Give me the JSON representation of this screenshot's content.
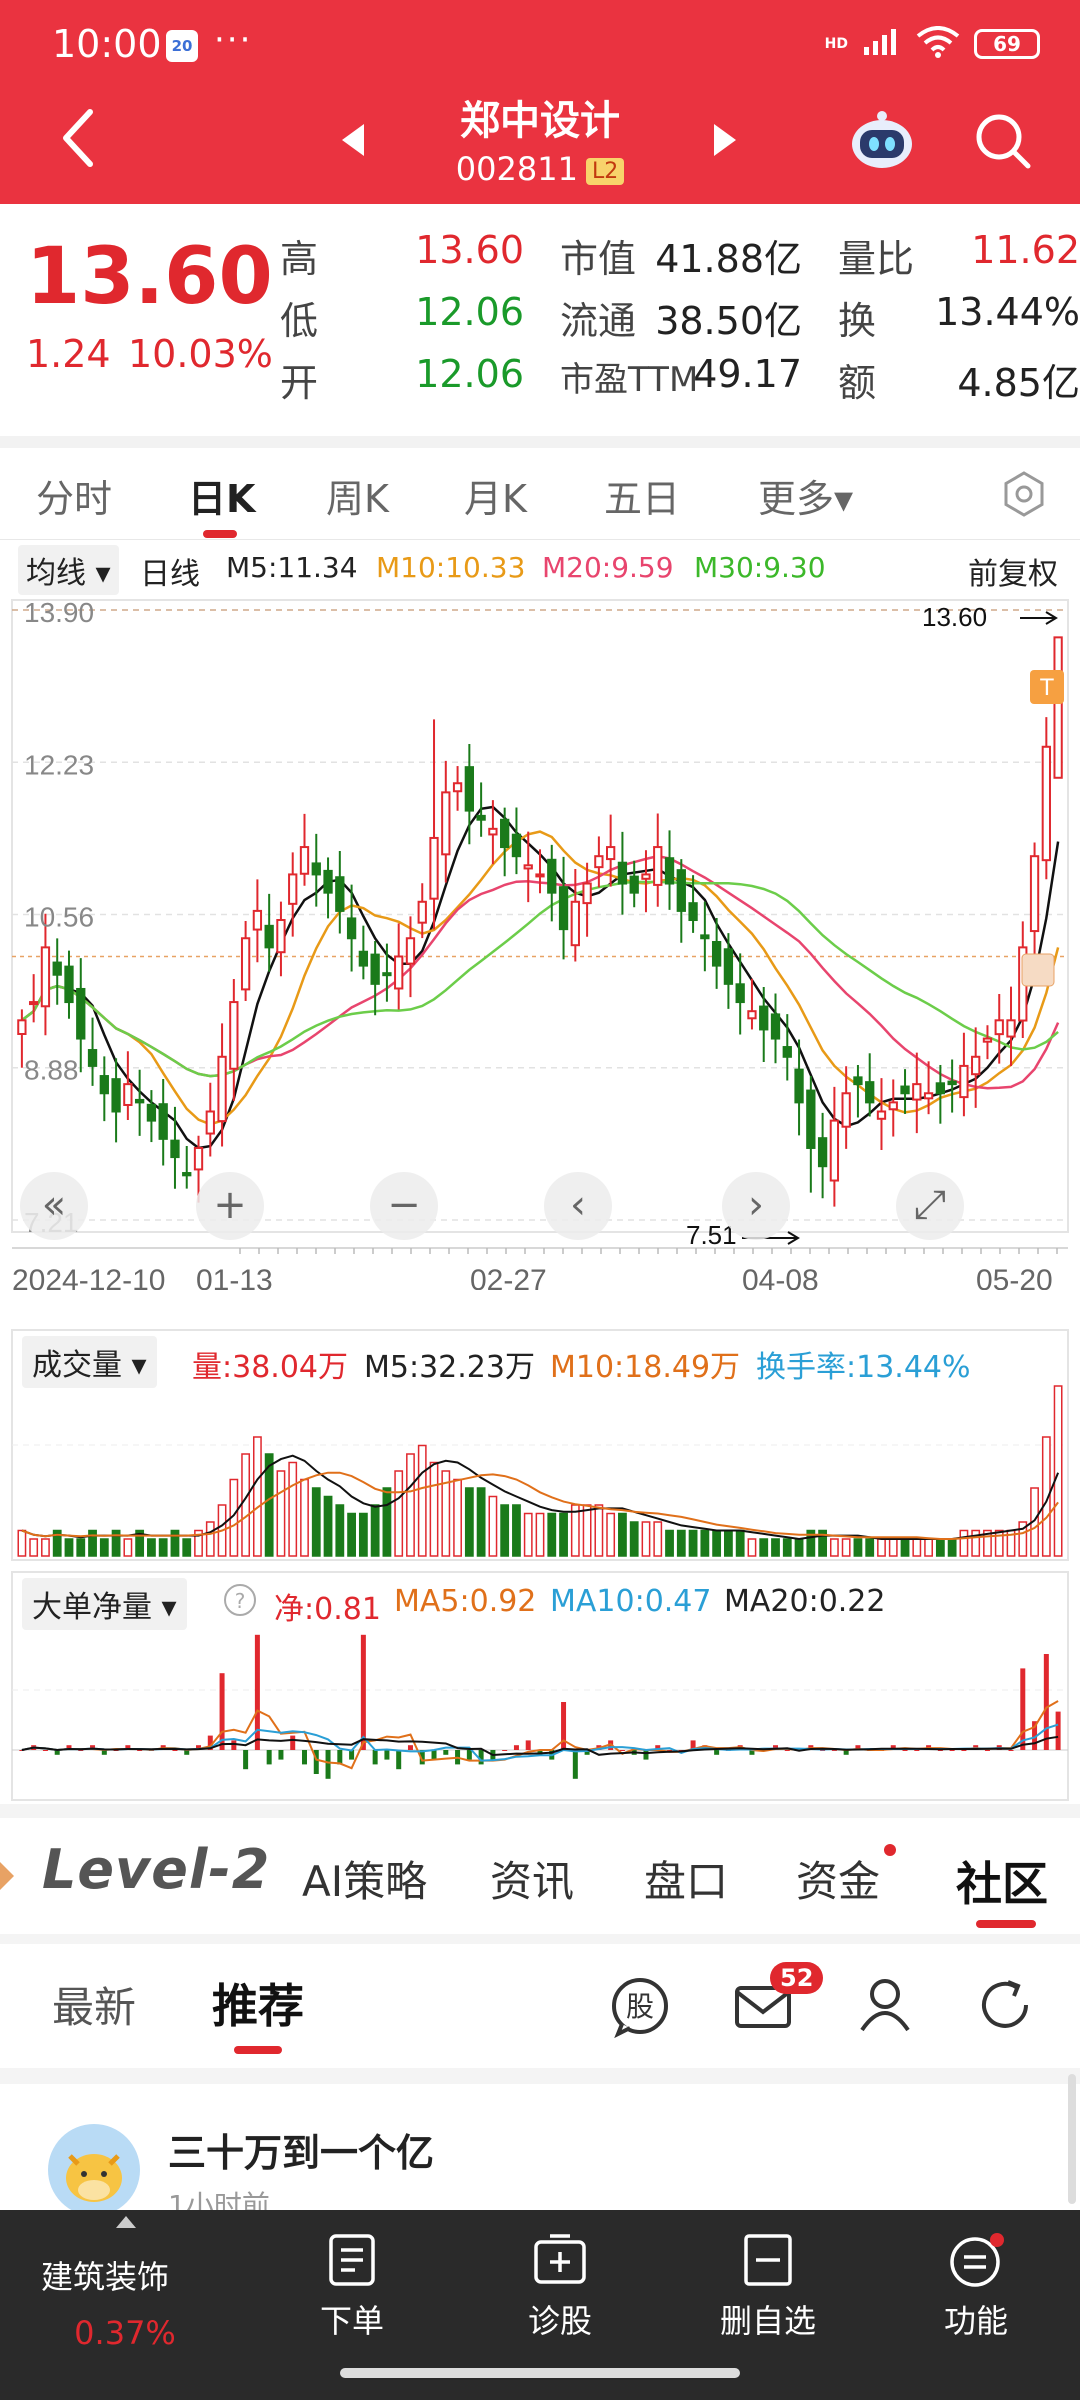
{
  "status": {
    "time": "10:00",
    "badge": "20",
    "dots": "···",
    "battery": "69",
    "network": "HD"
  },
  "header": {
    "name": "郑中设计",
    "code": "002811",
    "level": "L2"
  },
  "quote": {
    "price": "13.60",
    "change_abs": "1.24",
    "change_pct": "10.03%",
    "rows": [
      [
        {
          "label": "高",
          "value": "13.60"
        },
        {
          "label": "市值",
          "value": "41.88亿"
        },
        {
          "label": "量比",
          "value": "11.62"
        }
      ],
      [
        {
          "label": "低",
          "value": "12.06"
        },
        {
          "label": "流通",
          "value": "38.50亿"
        },
        {
          "label": "换",
          "value": "13.44%"
        }
      ],
      [
        {
          "label": "开",
          "value": "12.06"
        },
        {
          "label": "市盈TTM",
          "value": "49.17"
        },
        {
          "label": "额",
          "value": "4.85亿"
        }
      ]
    ]
  },
  "tabs": [
    "分时",
    "日K",
    "周K",
    "月K",
    "五日",
    "更多▾"
  ],
  "ma_row": {
    "dropdown": "均线 ▾",
    "period": "日线",
    "m5": "M5:11.34",
    "m10": "M10:10.33",
    "m20": "M20:9.59",
    "m30": "M30:9.30",
    "adjust": "前复权"
  },
  "colors": {
    "up": "#e0282e",
    "down": "#1a7a1a",
    "m5": "#111111",
    "m10": "#e89a17",
    "m20": "#e8456e",
    "m30": "#6ccd4a",
    "header": "#ea3340"
  },
  "chart_data": [
    {
      "type": "candlestick",
      "y_ticks": [
        "13.90",
        "12.23",
        "10.56",
        "8.88",
        "7.21"
      ],
      "ylim": [
        7.21,
        13.9
      ],
      "x_ticks": [
        "2024-12-10",
        "01-13",
        "02-27",
        "04-08",
        "05-20"
      ],
      "max_label": "13.60",
      "min_label": "7.51",
      "last_close": 13.6,
      "legend": [
        "M5:11.34",
        "M10:10.33",
        "M20:9.59",
        "M30:9.30"
      ],
      "closes": [
        9.4,
        9.6,
        10.2,
        9.9,
        9.6,
        9.2,
        8.9,
        8.6,
        8.4,
        8.7,
        8.5,
        8.3,
        8.1,
        7.9,
        7.7,
        8.0,
        8.4,
        9.0,
        9.6,
        10.3,
        10.6,
        10.2,
        10.5,
        11.0,
        11.3,
        11.0,
        10.8,
        10.6,
        10.3,
        10.0,
        9.8,
        9.9,
        10.1,
        10.3,
        10.7,
        11.4,
        11.9,
        12.0,
        11.7,
        11.6,
        11.5,
        11.3,
        11.2,
        11.1,
        11.0,
        10.8,
        10.4,
        10.7,
        10.9,
        11.2,
        11.3,
        10.9,
        10.8,
        11.0,
        11.3,
        10.9,
        10.6,
        10.5,
        10.3,
        10.0,
        9.8,
        9.6,
        9.5,
        9.3,
        9.2,
        9.0,
        8.5,
        8.0,
        7.8,
        8.3,
        8.6,
        8.7,
        8.5,
        8.4,
        8.5,
        8.6,
        8.7,
        8.6,
        8.6,
        8.7,
        8.9,
        9.0,
        9.2,
        9.4,
        9.4,
        10.2,
        11.2,
        12.4,
        13.6
      ]
    },
    {
      "type": "bar",
      "title": "成交量",
      "legend": [
        "量:38.04万",
        "M5:32.23万",
        "M10:18.49万",
        "换手率:13.44%"
      ],
      "values": [
        3,
        2,
        2,
        3,
        2,
        2,
        3,
        2,
        3,
        2,
        3,
        2,
        2,
        3,
        2,
        3,
        4,
        6,
        9,
        12,
        14,
        12,
        10,
        11,
        9,
        8,
        7,
        6,
        5,
        5,
        6,
        8,
        10,
        12,
        13,
        11,
        10,
        9,
        8,
        8,
        7,
        6,
        6,
        5,
        5,
        5,
        5,
        6,
        6,
        6,
        5,
        5,
        4,
        4,
        4,
        3,
        3,
        3,
        3,
        3,
        3,
        3,
        2,
        2,
        2,
        2,
        2,
        3,
        3,
        2,
        2,
        2,
        2,
        2,
        2,
        2,
        2,
        2,
        2,
        2,
        3,
        3,
        3,
        3,
        3,
        4,
        8,
        14,
        20
      ]
    },
    {
      "type": "bar",
      "title": "大单净量",
      "legend": [
        "净:0.81",
        "MA5:0.92",
        "MA10:0.47",
        "MA20:0.22"
      ],
      "values": [
        0,
        0.1,
        0,
        -0.1,
        0.1,
        0,
        0.1,
        -0.1,
        0,
        0.1,
        0,
        0,
        0.1,
        0,
        -0.1,
        0.1,
        0.3,
        1.6,
        0.2,
        -0.4,
        2.4,
        -0.3,
        -0.2,
        0.3,
        -0.3,
        -0.5,
        -0.6,
        -0.3,
        -0.2,
        2.4,
        -0.3,
        -0.2,
        -0.4,
        0.1,
        -0.3,
        -0.2,
        -0.1,
        -0.3,
        -0.2,
        -0.3,
        -0.2,
        0,
        0.1,
        0.2,
        -0.1,
        -0.2,
        1.0,
        -0.6,
        -0.1,
        0.1,
        0.2,
        0,
        -0.1,
        -0.2,
        0.1,
        0,
        0,
        0.2,
        0.1,
        -0.1,
        0,
        0.1,
        -0.1,
        0,
        0.1,
        0,
        0,
        0.1,
        0,
        0,
        -0.1,
        0.1,
        0,
        0,
        0.1,
        0,
        0,
        0.1,
        0,
        0,
        0,
        0.1,
        0,
        0.1,
        0,
        1.7,
        0.6,
        2.0,
        0.8
      ]
    }
  ],
  "nav2": {
    "level2": "Level-2",
    "items": [
      "AI策略",
      "资讯",
      "盘口",
      "资金",
      "社区"
    ]
  },
  "feed": {
    "tabs": [
      "最新",
      "推荐"
    ],
    "mail_badge": "52"
  },
  "post": {
    "author": "三十万到一个亿",
    "time": "1小时前"
  },
  "bottom": {
    "sector": "建筑装饰",
    "sector_pct": "0.37%",
    "items": [
      "下单",
      "诊股",
      "删自选",
      "功能"
    ]
  }
}
